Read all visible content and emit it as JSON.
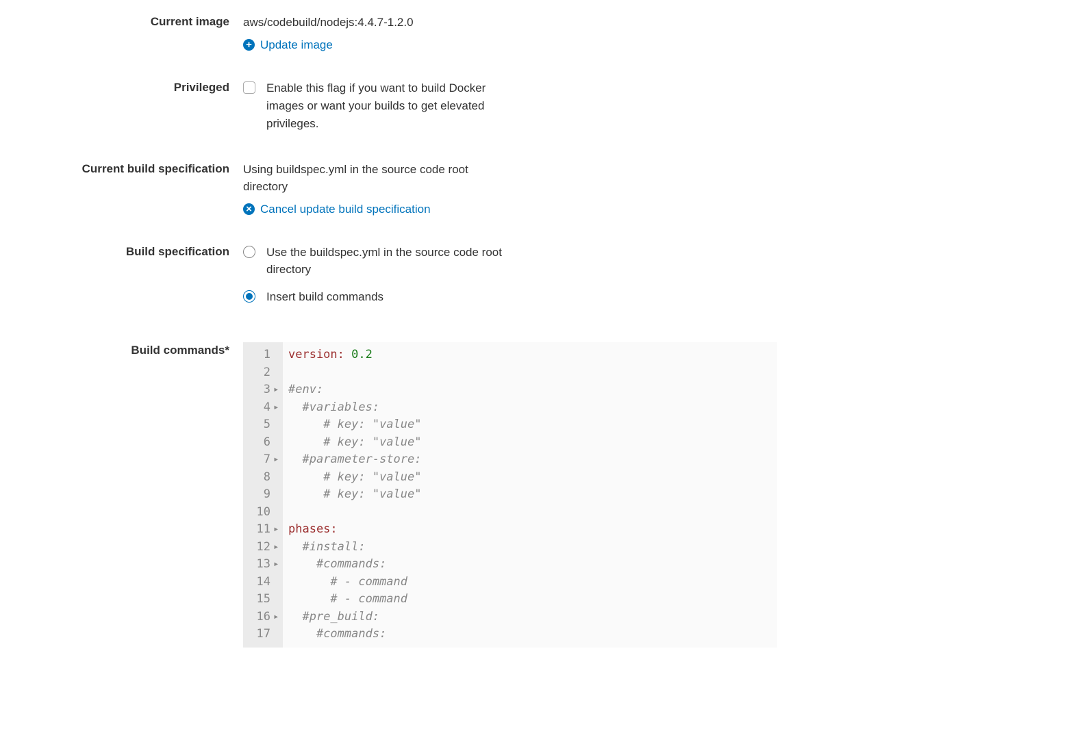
{
  "fields": {
    "currentImage": {
      "label": "Current image",
      "value": "aws/codebuild/nodejs:4.4.7-1.2.0",
      "action": "Update image"
    },
    "privileged": {
      "label": "Privileged",
      "description": "Enable this flag if you want to build Docker images or want your builds to get elevated privileges."
    },
    "currentBuildSpec": {
      "label": "Current build specification",
      "value": "Using buildspec.yml in the source code root directory",
      "action": "Cancel update build specification"
    },
    "buildSpec": {
      "label": "Build specification",
      "options": [
        "Use the buildspec.yml in the source code root directory",
        "Insert build commands"
      ]
    },
    "buildCommands": {
      "label": "Build commands*"
    }
  },
  "code": {
    "lines": [
      {
        "n": 1,
        "fold": "",
        "segments": [
          {
            "t": "key",
            "v": "version:"
          },
          {
            "t": "plain",
            "v": " "
          },
          {
            "t": "value",
            "v": "0.2"
          }
        ]
      },
      {
        "n": 2,
        "fold": "",
        "segments": []
      },
      {
        "n": 3,
        "fold": "▸",
        "segments": [
          {
            "t": "comment",
            "v": "#env:"
          }
        ]
      },
      {
        "n": 4,
        "fold": "▸",
        "segments": [
          {
            "t": "plain",
            "v": "  "
          },
          {
            "t": "comment",
            "v": "#variables:"
          }
        ]
      },
      {
        "n": 5,
        "fold": "",
        "segments": [
          {
            "t": "plain",
            "v": "     "
          },
          {
            "t": "comment",
            "v": "# key: \"value\""
          }
        ]
      },
      {
        "n": 6,
        "fold": "",
        "segments": [
          {
            "t": "plain",
            "v": "     "
          },
          {
            "t": "comment",
            "v": "# key: \"value\""
          }
        ]
      },
      {
        "n": 7,
        "fold": "▸",
        "segments": [
          {
            "t": "plain",
            "v": "  "
          },
          {
            "t": "comment",
            "v": "#parameter-store:"
          }
        ]
      },
      {
        "n": 8,
        "fold": "",
        "segments": [
          {
            "t": "plain",
            "v": "     "
          },
          {
            "t": "comment",
            "v": "# key: \"value\""
          }
        ]
      },
      {
        "n": 9,
        "fold": "",
        "segments": [
          {
            "t": "plain",
            "v": "     "
          },
          {
            "t": "comment",
            "v": "# key: \"value\""
          }
        ]
      },
      {
        "n": 10,
        "fold": "",
        "segments": []
      },
      {
        "n": 11,
        "fold": "▸",
        "segments": [
          {
            "t": "key",
            "v": "phases:"
          }
        ]
      },
      {
        "n": 12,
        "fold": "▸",
        "segments": [
          {
            "t": "plain",
            "v": "  "
          },
          {
            "t": "comment",
            "v": "#install:"
          }
        ]
      },
      {
        "n": 13,
        "fold": "▸",
        "segments": [
          {
            "t": "plain",
            "v": "    "
          },
          {
            "t": "comment",
            "v": "#commands:"
          }
        ]
      },
      {
        "n": 14,
        "fold": "",
        "segments": [
          {
            "t": "plain",
            "v": "      "
          },
          {
            "t": "comment",
            "v": "# - command"
          }
        ]
      },
      {
        "n": 15,
        "fold": "",
        "segments": [
          {
            "t": "plain",
            "v": "      "
          },
          {
            "t": "comment",
            "v": "# - command"
          }
        ]
      },
      {
        "n": 16,
        "fold": "▸",
        "segments": [
          {
            "t": "plain",
            "v": "  "
          },
          {
            "t": "comment",
            "v": "#pre_build:"
          }
        ]
      },
      {
        "n": 17,
        "fold": "",
        "segments": [
          {
            "t": "plain",
            "v": "    "
          },
          {
            "t": "comment",
            "v": "#commands:"
          }
        ]
      }
    ]
  }
}
